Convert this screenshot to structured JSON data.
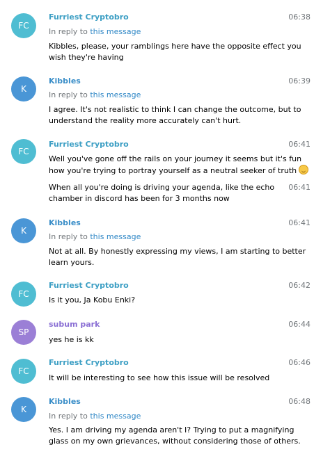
{
  "colors": {
    "avatar_fc": "#4fbdd2",
    "avatar_k": "#4a96d6",
    "avatar_sp": "#9b7fd6",
    "name_fc": "#3d9fc4",
    "name_k": "#3a8ec8",
    "name_sp": "#8a6fd4",
    "reply_link": "#2f87c6"
  },
  "reply_prefix": "In reply to",
  "reply_link": "this message",
  "messages": [
    {
      "avatar": "FC",
      "author": "Furriest Cryptobro",
      "time": "06:38",
      "text": "Kibbles, please, your ramblings here have the opposite effect you wish they're having"
    },
    {
      "avatar": "K",
      "author": "Kibbles",
      "time": "06:39",
      "text": "I agree. It's not realistic to think I can change the outcome, but to understand the reality more accurately can't hurt."
    },
    {
      "avatar": "FC",
      "author": "Furriest Cryptobro",
      "time": "06:41",
      "text": "Well you've gone off the rails on your journey it seems but it's fun how you're trying to portray yourself as a neutral seeker of truth",
      "emoji": "grinning-sweat-emoji"
    },
    {
      "time": "06:41",
      "text": "When all you're doing is driving your agenda, like the echo chamber in discord has been for 3 months now"
    },
    {
      "avatar": "K",
      "author": "Kibbles",
      "time": "06:41",
      "text": "Not at all. By honestly expressing my views, I am starting to better learn yours."
    },
    {
      "avatar": "FC",
      "author": "Furriest Cryptobro",
      "time": "06:42",
      "text": "Is it you, Ja Kobu Enki?"
    },
    {
      "avatar": "SP",
      "author": "subum park",
      "time": "06:44",
      "text": "yes he is kk"
    },
    {
      "avatar": "FC",
      "author": "Furriest Cryptobro",
      "time": "06:46",
      "text": "It will be interesting to see how this issue will be resolved"
    },
    {
      "avatar": "K",
      "author": "Kibbles",
      "time": "06:48",
      "text": "Yes. I am driving my agenda aren't I? Trying to put a magnifying glass on my own grievances, without considering those of others."
    }
  ]
}
